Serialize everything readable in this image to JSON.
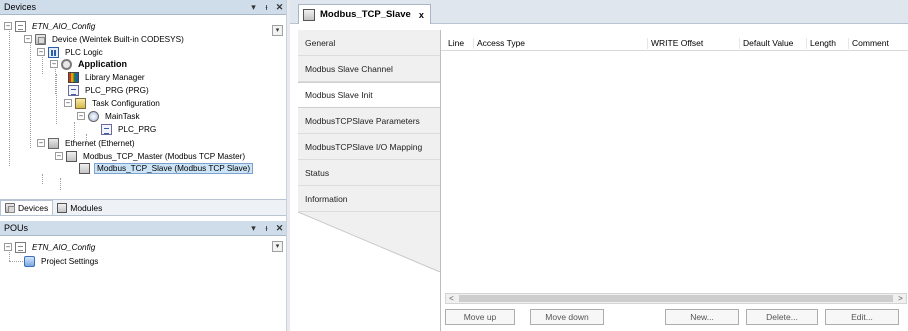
{
  "devices_panel": {
    "title": "Devices",
    "pin_glyph": "▾",
    "dock_glyph": "ᵻ",
    "close_glyph": "✕"
  },
  "device_tree": [
    {
      "label": "ETN_AIO_Config",
      "icon": "project-icon"
    },
    {
      "label": "Device (Weintek Built-in CODESYS)",
      "icon": "device-icon"
    },
    {
      "label": "PLC Logic",
      "icon": "plc-logic-icon"
    },
    {
      "label": "Application",
      "icon": "application-gear-icon"
    },
    {
      "label": "Library Manager",
      "icon": "library-manager-icon"
    },
    {
      "label": "PLC_PRG (PRG)",
      "icon": "pou-icon"
    },
    {
      "label": "Task Configuration",
      "icon": "task-configuration-icon"
    },
    {
      "label": "MainTask",
      "icon": "main-task-icon"
    },
    {
      "label": "PLC_PRG",
      "icon": "task-program-call-icon"
    },
    {
      "label": "Ethernet (Ethernet)",
      "icon": "ethernet-icon"
    },
    {
      "label": "Modbus_TCP_Master (Modbus TCP Master)",
      "icon": "modbus-master-icon"
    },
    {
      "label": "Modbus_TCP_Slave (Modbus TCP Slave)",
      "icon": "modbus-slave-icon"
    }
  ],
  "bottom_tabs": [
    {
      "label": "Devices",
      "icon": "devices-tab-icon"
    },
    {
      "label": "Modules",
      "icon": "modules-tab-icon"
    }
  ],
  "pous_panel": {
    "title": "POUs",
    "pin_glyph": "▾",
    "dock_glyph": "ᵻ",
    "close_glyph": "✕"
  },
  "pou_tree": [
    {
      "label": "ETN_AIO_Config",
      "icon": "project-icon"
    },
    {
      "label": "Project Settings",
      "icon": "project-settings-icon"
    }
  ],
  "editor": {
    "tab_title": "Modbus_TCP_Slave",
    "tab_close": "x",
    "nav_items": [
      "General",
      "Modbus Slave Channel",
      "Modbus Slave Init",
      "ModbusTCPSlave Parameters",
      "ModbusTCPSlave I/O Mapping",
      "Status",
      "Information"
    ],
    "active_nav": "Modbus Slave Init",
    "columns": [
      "Line",
      "Access Type",
      "WRITE Offset",
      "Default Value",
      "Length",
      "Comment"
    ],
    "scroll_left": "<",
    "scroll_right": ">",
    "buttons": [
      "Move up",
      "Move down",
      "New...",
      "Delete...",
      "Edit..."
    ]
  },
  "colors": {
    "panel_header": "#cfdcea",
    "selection": "#cce4f7",
    "nav_bg": "#f0f0f0"
  }
}
